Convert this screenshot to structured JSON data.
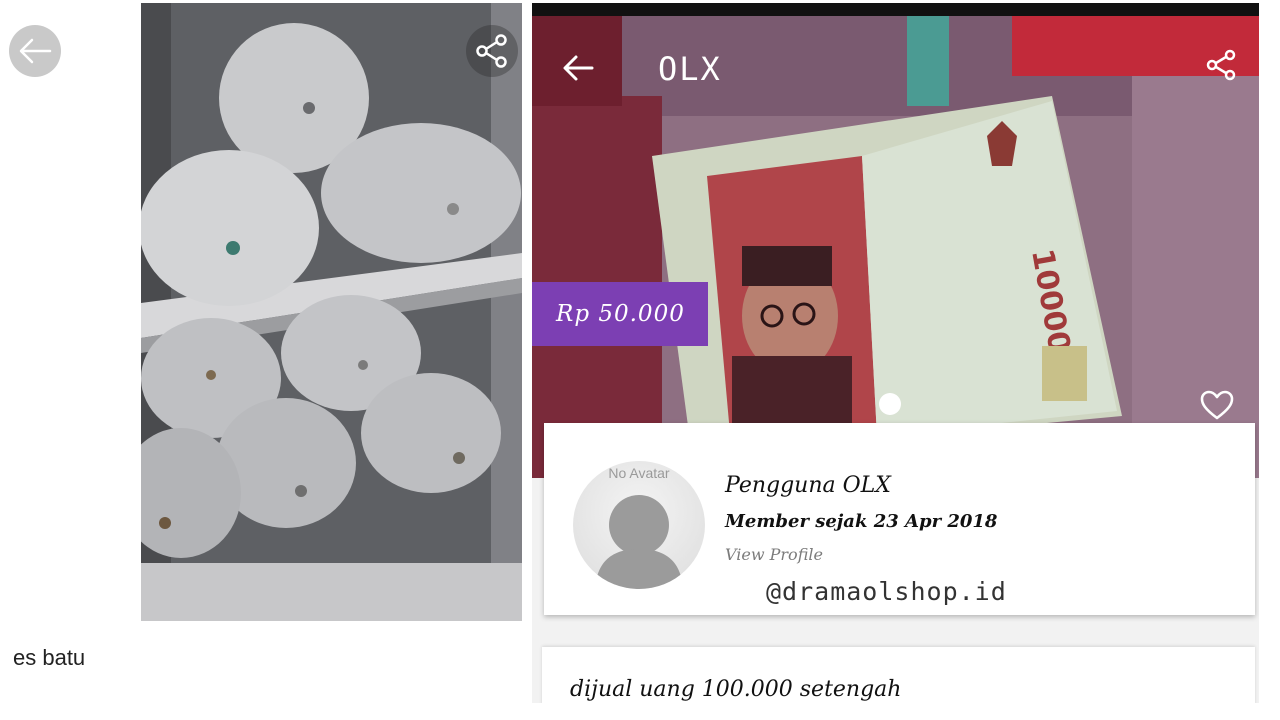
{
  "left_listing": {
    "back_icon": "arrow-left-icon",
    "share_icon": "share-icon",
    "caption": "es batu"
  },
  "right_listing": {
    "app_title": "OLX",
    "back_icon": "arrow-left-icon",
    "share_icon": "share-icon",
    "price": "Rp  50.000",
    "favorite_icon": "heart-icon",
    "accent_color": "#7c3fb3",
    "seller": {
      "avatar_placeholder": "No Avatar",
      "name": "Pengguna OLX",
      "member_since": "Member sejak 23 Apr 2018",
      "view_profile": "View Profile"
    },
    "watermark": "@dramaolshop.id",
    "description": "dijual uang 100.000 setengah",
    "banknote_value": "100000"
  }
}
